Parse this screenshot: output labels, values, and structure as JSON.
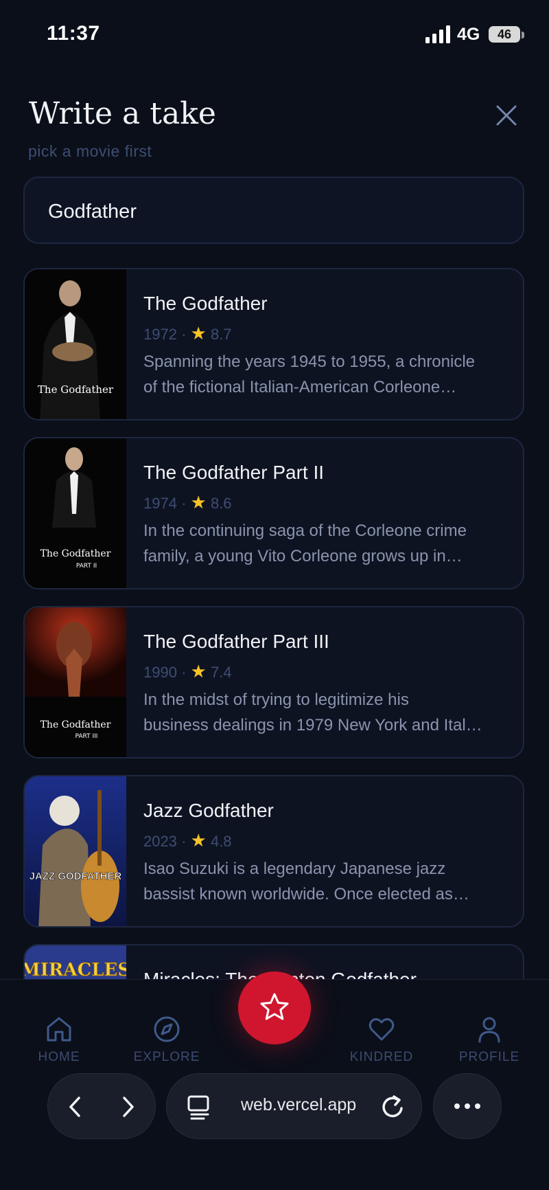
{
  "status": {
    "time": "11:37",
    "network": "4G",
    "battery": "46"
  },
  "header": {
    "title": "Write a take",
    "subtitle": "pick a movie first"
  },
  "search": {
    "value": "Godfather"
  },
  "results": [
    {
      "title": "The Godfather",
      "year": "1972",
      "rating": "8.7",
      "desc_line1": "Spanning the years 1945 to 1955, a chronicle",
      "desc_line2": "of the fictional Italian-American Corleone…",
      "poster_text": "The Godfather"
    },
    {
      "title": "The Godfather Part II",
      "year": "1974",
      "rating": "8.6",
      "desc_line1": "In the continuing saga of the Corleone crime",
      "desc_line2": "family, a young Vito Corleone grows up in…",
      "poster_text": "The Godfather"
    },
    {
      "title": "The Godfather Part III",
      "year": "1990",
      "rating": "7.4",
      "desc_line1": "In the midst of trying to legitimize his",
      "desc_line2": "business dealings in 1979 New York and Ital…",
      "poster_text": "The Godfather"
    },
    {
      "title": "Jazz Godfather",
      "year": "2023",
      "rating": "4.8",
      "desc_line1": "Isao Suzuki is a legendary Japanese jazz",
      "desc_line2": "bassist known worldwide. Once elected as…",
      "poster_text": "JAZZ GODFATHER"
    },
    {
      "title": "Miracles: The Canton Godfather",
      "poster_text": "MIRACLES"
    }
  ],
  "nav": {
    "home": "HOME",
    "explore": "EXPLORE",
    "kindred": "KINDRED",
    "profile": "PROFILE"
  },
  "browser": {
    "url": "web.vercel.app"
  },
  "colors": {
    "accent": "#d0162f",
    "background": "#0b0f19",
    "card": "#0e1322",
    "star": "#f7c325"
  }
}
